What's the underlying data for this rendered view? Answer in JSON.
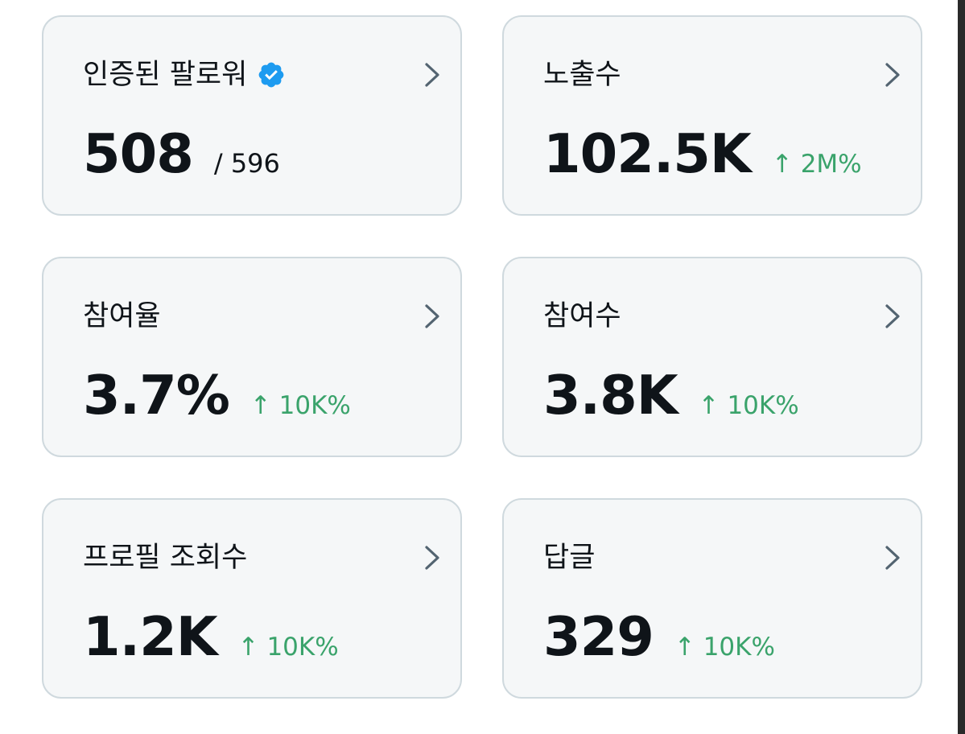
{
  "cards": [
    {
      "label": "인증된 팔로워",
      "value": "508",
      "sub": "/ 596",
      "change": "",
      "verified_icon": "verified-badge-icon"
    },
    {
      "label": "노출수",
      "value": "102.5K",
      "sub": "",
      "change": "↑ 2M%"
    },
    {
      "label": "참여율",
      "value": "3.7%",
      "sub": "",
      "change": "↑ 10K%"
    },
    {
      "label": "참여수",
      "value": "3.8K",
      "sub": "",
      "change": "↑ 10K%"
    },
    {
      "label": "프로필 조회수",
      "value": "1.2K",
      "sub": "",
      "change": "↑ 10K%"
    },
    {
      "label": "답글",
      "value": "329",
      "sub": "",
      "change": "↑ 10K%"
    }
  ],
  "colors": {
    "card_background": "#f5f7f8",
    "card_border": "#cfd9de",
    "text_primary": "#0f1419",
    "chevron": "#536471",
    "positive_change": "#3aa36b",
    "verified_badge": "#1d9bf0"
  },
  "icons": {
    "chevron": "chevron-right-icon",
    "verified": "verified-badge-icon"
  }
}
